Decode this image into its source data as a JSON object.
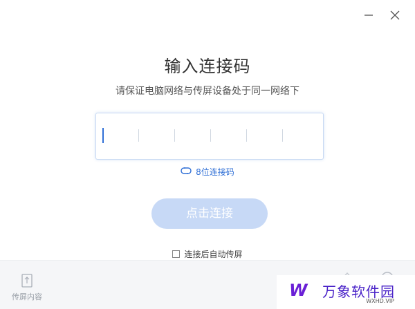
{
  "window": {
    "minimize_icon": "minimize-icon",
    "close_icon": "close-icon"
  },
  "title": "输入连接码",
  "subtitle": "请保证电脑网络与传屏设备处于同一网络下",
  "code_input": {
    "digits": 8,
    "value": ""
  },
  "mode_switch_label": "8位连接码",
  "connect_button_label": "点击连接",
  "auto_share": {
    "label": "连接后自动传屏",
    "checked": false
  },
  "bottom_bar": {
    "share_content_label": "传屏内容"
  },
  "watermark": {
    "logo": "W",
    "text": "万象软件园",
    "url": "WXHD.VIP"
  },
  "colors": {
    "accent": "#2f6fd6",
    "button_disabled": "#c7d9f6",
    "watermark": "#4a23c8"
  }
}
